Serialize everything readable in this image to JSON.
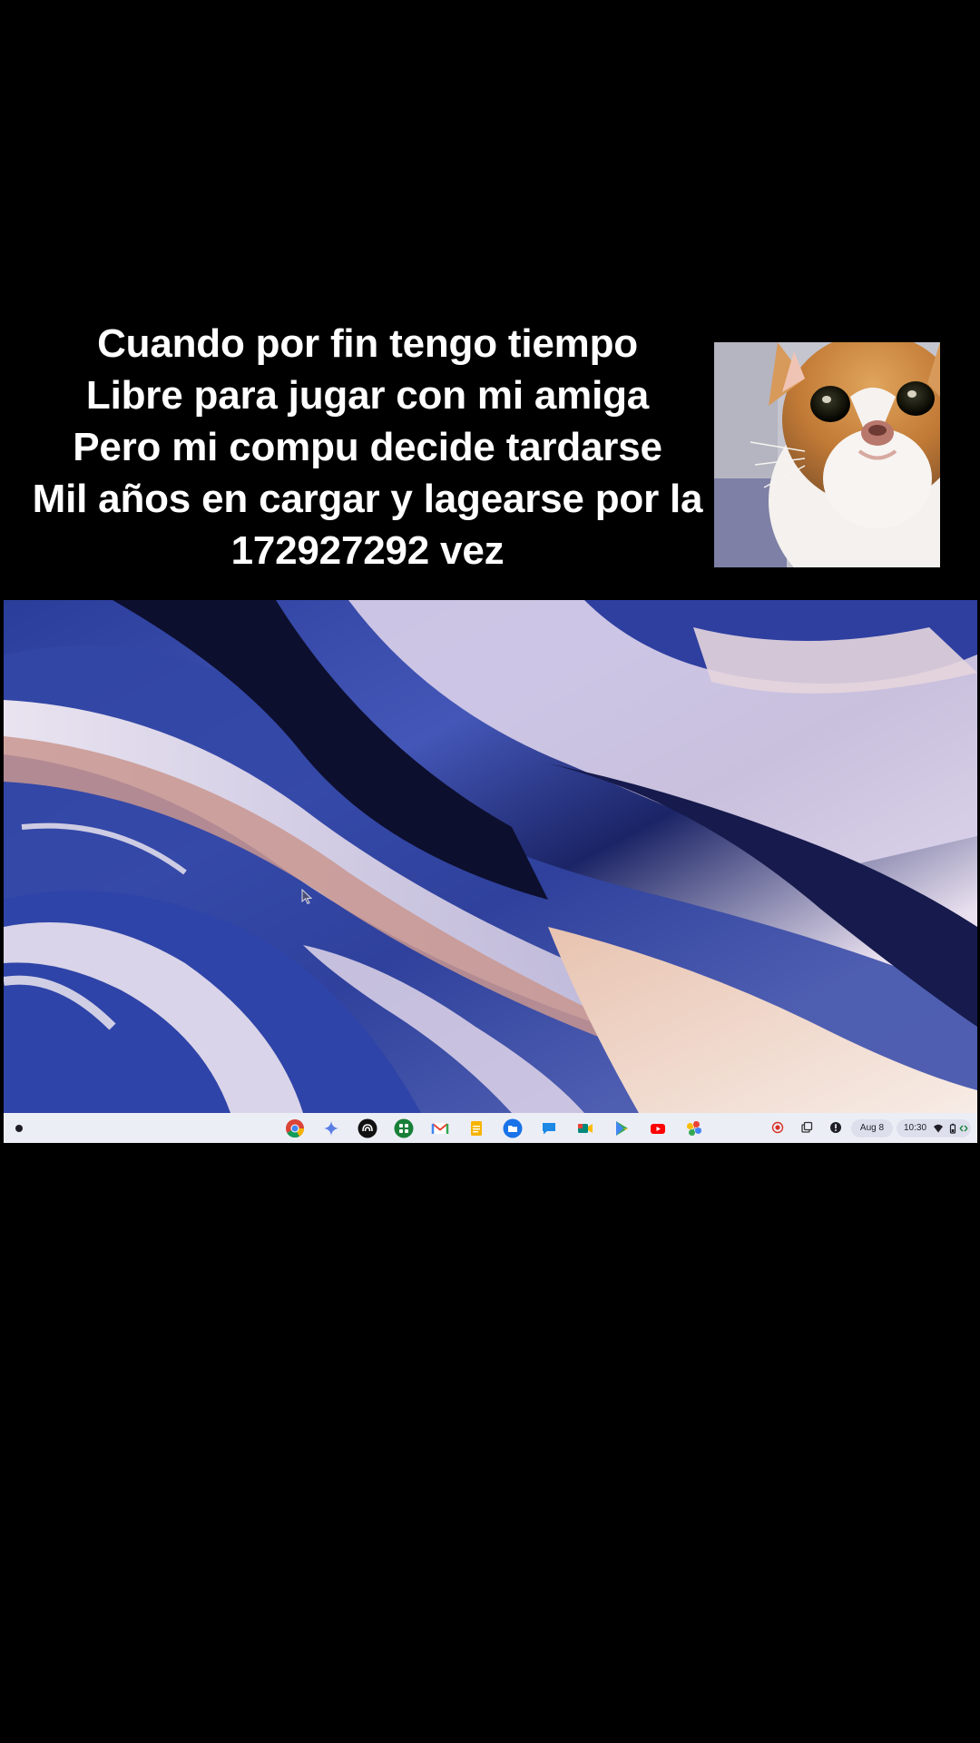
{
  "caption": {
    "lines": [
      "Cuando por fin tengo tiempo",
      "Libre para jugar con mi amiga",
      "Pero mi compu decide tardarse",
      "Mil años en cargar y lagearse por la",
      "172927292 vez"
    ]
  },
  "reaction_image": {
    "subject": "cat-face"
  },
  "screen": {
    "wallpaper": {
      "colors": [
        "#1c2a70",
        "#3b4fb0",
        "#eae3f0",
        "#c9a3a6",
        "#0e1030"
      ]
    },
    "shelf": {
      "launcher_icon": "launcher-icon",
      "apps": [
        {
          "name": "chrome-icon"
        },
        {
          "name": "gemini-icon"
        },
        {
          "name": "stadia-icon"
        },
        {
          "name": "app-grid-icon"
        },
        {
          "name": "gmail-icon"
        },
        {
          "name": "docs-icon"
        },
        {
          "name": "files-icon"
        },
        {
          "name": "chat-icon"
        },
        {
          "name": "meet-icon"
        },
        {
          "name": "play-store-icon"
        },
        {
          "name": "youtube-icon"
        },
        {
          "name": "photos-icon"
        }
      ],
      "tray": {
        "record_icon": "screen-record-icon",
        "clipboard_icon": "clipboard-icon",
        "notification_icon": "notification-icon",
        "date": "Aug 8",
        "time": "10:30",
        "wifi_icon": "wifi-icon",
        "battery_icon": "battery-icon"
      }
    }
  }
}
